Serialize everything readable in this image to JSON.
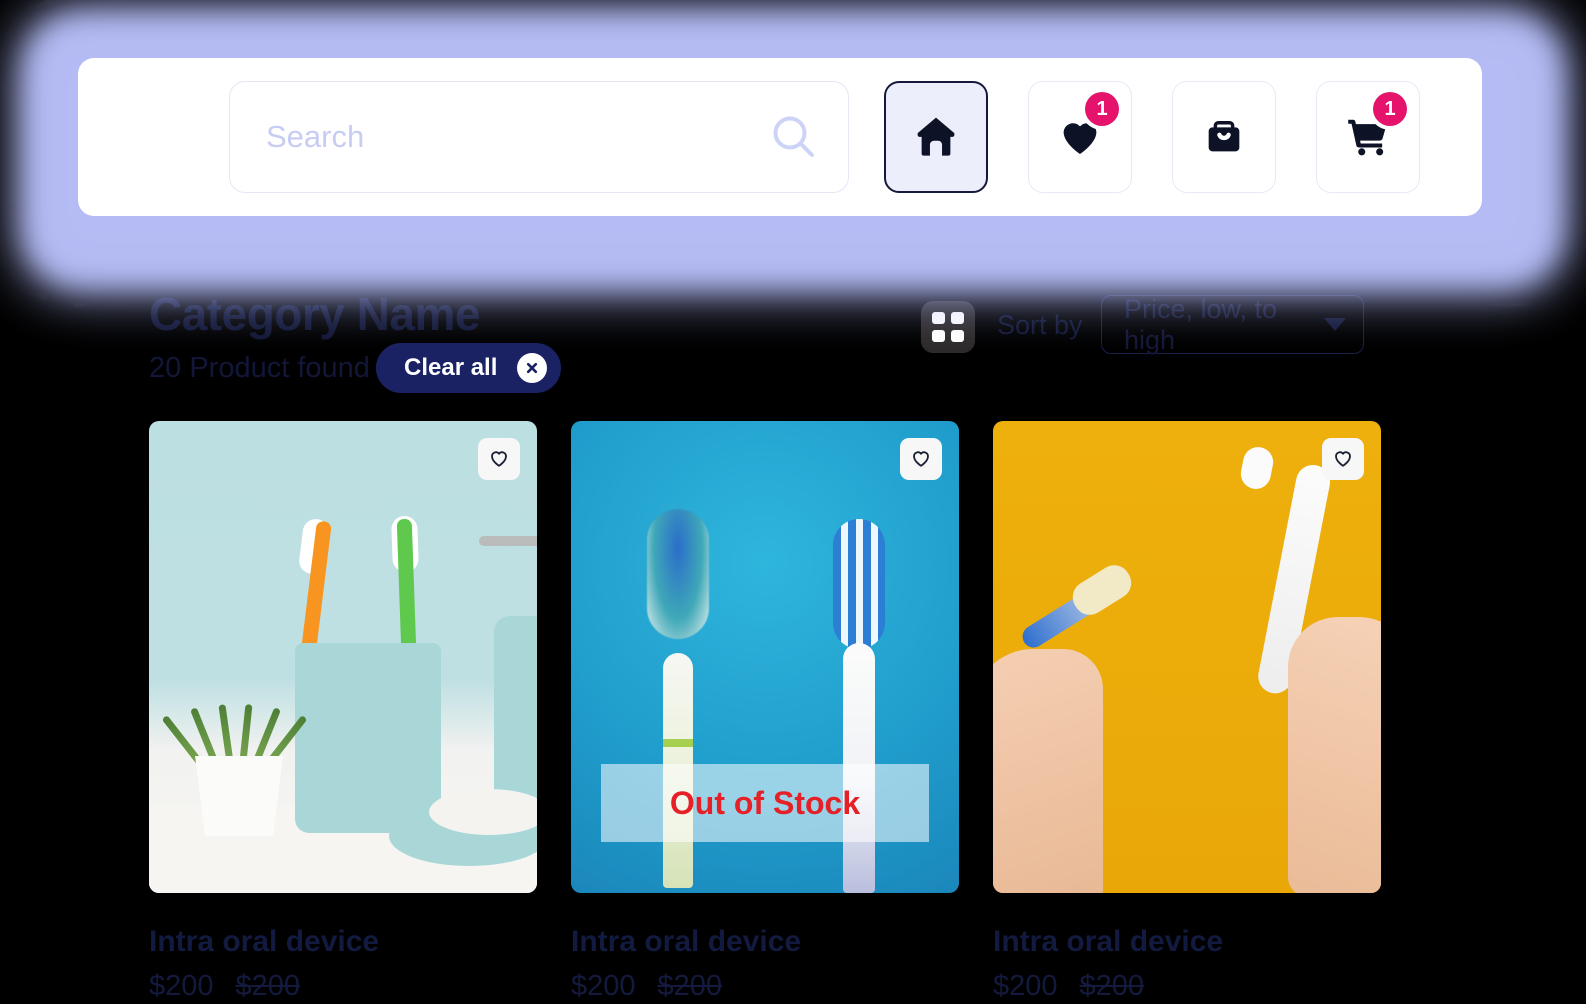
{
  "header": {
    "search": {
      "placeholder": "Search",
      "value": "",
      "icon": "search-icon"
    },
    "nav": [
      {
        "icon": "home-icon",
        "label": "Home",
        "active": true,
        "badge": null
      },
      {
        "icon": "heart-icon",
        "label": "Wishlist",
        "active": false,
        "badge": "1"
      },
      {
        "icon": "shopping-bag-icon",
        "label": "Orders",
        "active": false,
        "badge": null
      },
      {
        "icon": "shopping-cart-icon",
        "label": "Cart",
        "active": false,
        "badge": "1"
      }
    ]
  },
  "category": {
    "title": "Category Name",
    "count_text": "20 Product found",
    "clear_all_label": "Clear all",
    "clear_all_icon": "close-circle-icon"
  },
  "toolbar": {
    "grid_view_icon": "grid-view-icon",
    "sort_label": "Sort by",
    "sort_value": "Price, low, to high",
    "sort_caret_icon": "chevron-down-icon",
    "sort_options": [
      "Price, low, to high"
    ]
  },
  "products": [
    {
      "title": "Intra oral device",
      "price": "$200",
      "original_price": "$200",
      "favorite_icon": "heart-outline-icon",
      "out_of_stock": false,
      "out_of_stock_label": ""
    },
    {
      "title": "Intra oral device",
      "price": "$200",
      "original_price": "$200",
      "favorite_icon": "heart-outline-icon",
      "out_of_stock": true,
      "out_of_stock_label": "Out of Stock"
    },
    {
      "title": "Intra oral device",
      "price": "$200",
      "original_price": "$200",
      "favorite_icon": "heart-outline-icon",
      "out_of_stock": false,
      "out_of_stock_label": ""
    }
  ],
  "colors": {
    "page_background": "#000000",
    "glow": "#aeb7f2",
    "header_card": "#ffffff",
    "active_nav_bg": "#eceefb",
    "badge": "#e6136c",
    "navy": "#1b2263",
    "text_dark": "#131a40",
    "out_of_stock_red": "#e52027",
    "grid_toggle_bg": "#2e2b2b"
  }
}
